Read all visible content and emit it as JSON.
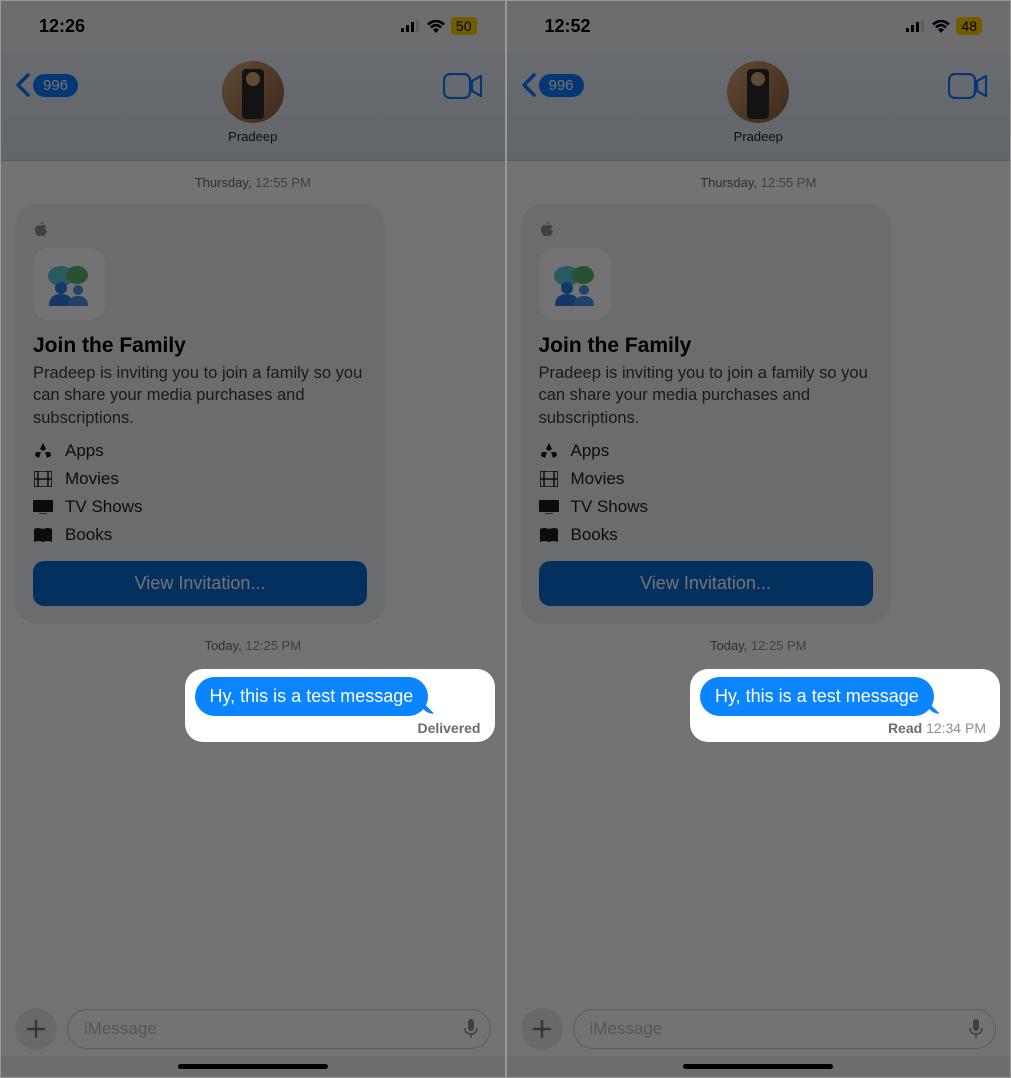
{
  "left": {
    "status": {
      "time": "12:26",
      "battery": "50"
    },
    "nav": {
      "badge": "996",
      "contact": "Pradeep"
    },
    "ts1": {
      "day": "Thursday,",
      "time": "12:55 PM"
    },
    "card": {
      "title": "Join the Family",
      "desc": "Pradeep is inviting you to join a family so you can share your media purchases and subscriptions.",
      "features": [
        "Apps",
        "Movies",
        "TV Shows",
        "Books"
      ],
      "button": "View Invitation..."
    },
    "ts2": {
      "day": "Today,",
      "time": "12:25 PM"
    },
    "msg": "Hy, this is a test message",
    "receipt": {
      "label": "Delivered",
      "time": ""
    },
    "input": {
      "placeholder": "iMessage"
    }
  },
  "right": {
    "status": {
      "time": "12:52",
      "battery": "48"
    },
    "nav": {
      "badge": "996",
      "contact": "Pradeep"
    },
    "ts1": {
      "day": "Thursday,",
      "time": "12:55 PM"
    },
    "card": {
      "title": "Join the Family",
      "desc": "Pradeep is inviting you to join a family so you can share your media purchases and subscriptions.",
      "features": [
        "Apps",
        "Movies",
        "TV Shows",
        "Books"
      ],
      "button": "View Invitation..."
    },
    "ts2": {
      "day": "Today,",
      "time": "12:25 PM"
    },
    "msg": "Hy, this is a test message",
    "receipt": {
      "label": "Read",
      "time": "12:34 PM"
    },
    "input": {
      "placeholder": "iMessage"
    }
  }
}
